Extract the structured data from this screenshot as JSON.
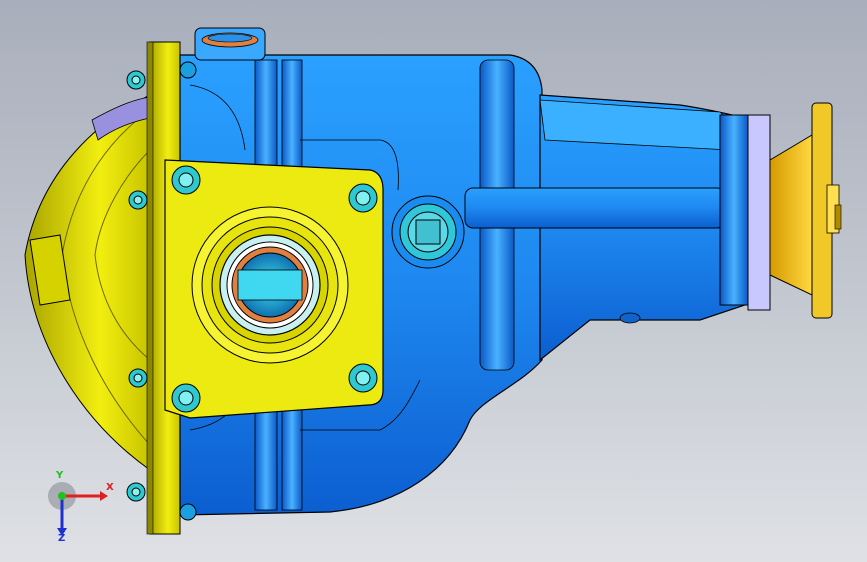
{
  "viewport": {
    "background_top": "#a8aebb",
    "background_bottom": "#dfe1e5"
  },
  "model": {
    "part": "differential-housing",
    "colors": {
      "housing": "#1e90ff",
      "housing_dark": "#0a4fc4",
      "housing_light": "#6fc3ff",
      "flange": "#e6e200",
      "flange_dark": "#8c8800",
      "bolt": "#30d0d0",
      "bearing_ring": "#e08040",
      "seal": "#b0b0e0",
      "edge": "#000000"
    }
  },
  "triad": {
    "x_label": "X",
    "y_label": "Y",
    "z_label": "Z",
    "x_color": "#e02020",
    "y_color": "#20c020",
    "z_color": "#2030d0"
  }
}
